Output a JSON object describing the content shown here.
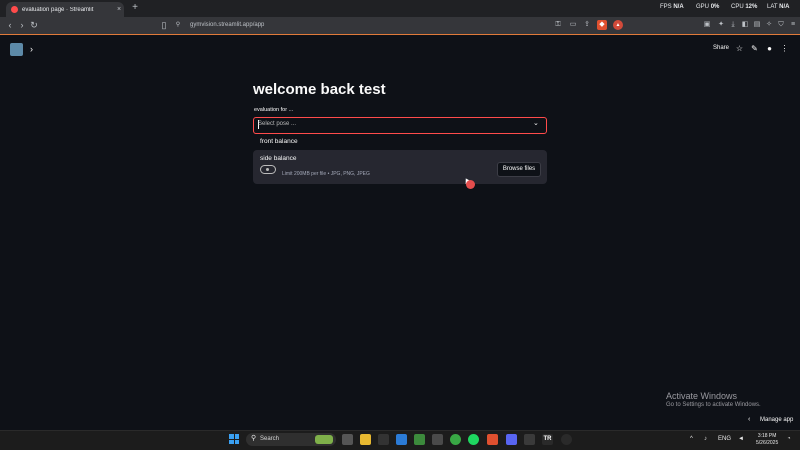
{
  "browser": {
    "tab_title": "evaluation page · Streamlit",
    "tab_close": "×",
    "new_tab": "+",
    "url": "gymvision.streamlit.app/app",
    "stats": {
      "fps_label": "FPS",
      "fps_value": "N/A",
      "gpu_label": "GPU",
      "gpu_value": "0%",
      "cpu_label": "CPU",
      "cpu_value": "12%",
      "lat_label": "LAT",
      "lat_value": "N/A"
    },
    "window_controls": [
      "–",
      "□",
      "×"
    ]
  },
  "app_header": {
    "share_label": "Share",
    "icons": [
      "star-icon",
      "edit-icon",
      "github-icon",
      "menu-icon"
    ]
  },
  "main": {
    "title": "welcome back test",
    "select_label": "evaluation for ...",
    "select_placeholder": "Select pose ...",
    "options": [
      "front balance",
      "side balance"
    ],
    "uploader": {
      "limit_text": "Limit 200MB per file • JPG, PNG, JPEG",
      "browse_label": "Browse files"
    }
  },
  "watermark": {
    "title": "Activate Windows",
    "subtitle": "Go to Settings to activate Windows."
  },
  "manage_app": "Manage app",
  "taskbar": {
    "search_placeholder": "Search",
    "lang": "ENG",
    "time": "3:18 PM",
    "date": "5/26/2025"
  },
  "colors": {
    "background": "#0e1117",
    "accent": "#ff4b4b",
    "surface": "#262730"
  }
}
